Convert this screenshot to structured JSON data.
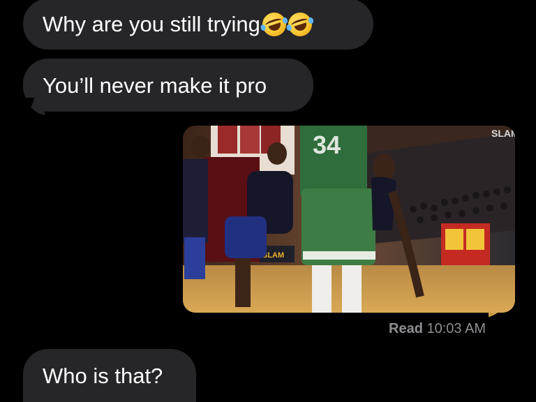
{
  "messages": [
    {
      "direction": "incoming",
      "text": "Why are you still trying",
      "emoji": [
        "rolling-on-floor-laughing",
        "rolling-on-floor-laughing"
      ]
    },
    {
      "direction": "incoming",
      "text": "You’ll never make it pro"
    },
    {
      "direction": "outgoing",
      "type": "video",
      "jersey_number": "34",
      "watermark": "SLAM",
      "court_banner": "SLAM"
    },
    {
      "direction": "incoming",
      "text": "Who is that?"
    }
  ],
  "receipt": {
    "label": "Read",
    "time": "10:03 AM"
  },
  "colors": {
    "background": "#000000",
    "incoming_bubble": "#262628",
    "bubble_text": "#ffffff",
    "receipt_text": "#8e8e93"
  }
}
